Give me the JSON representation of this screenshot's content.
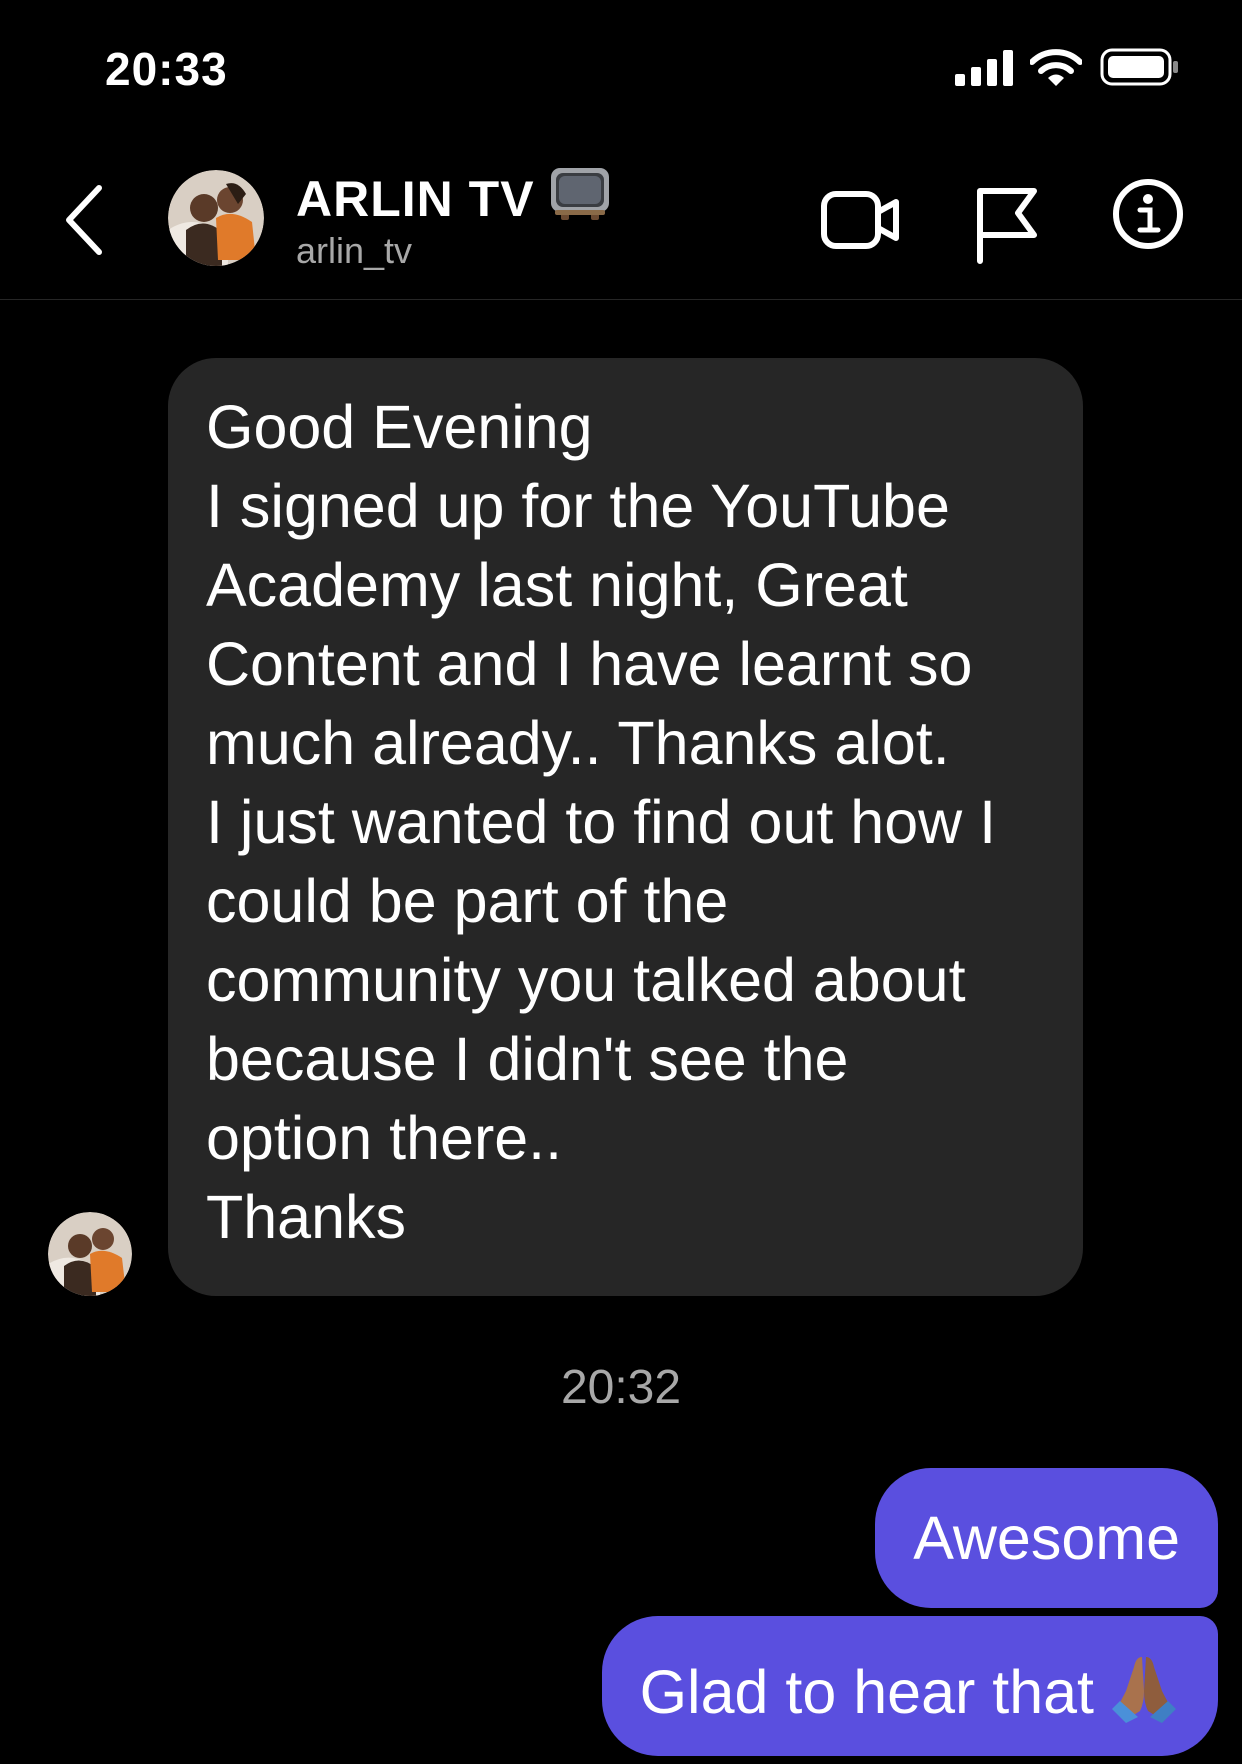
{
  "status_bar": {
    "time": "20:33"
  },
  "header": {
    "name": "ARLIN TV",
    "username": "arlin_tv",
    "icons": [
      "back-icon",
      "tv-icon",
      "video-call-icon",
      "flag-icon",
      "info-icon"
    ]
  },
  "messages": {
    "incoming": {
      "lines": [
        "Good Evening",
        "I signed up for the YouTube",
        "Academy last night, Great",
        "Content and I have learnt so",
        "much already.. Thanks alot.",
        "I just wanted to find out how I",
        "could be part of the",
        "community you talked about",
        "because I didn't see the",
        "option there..",
        "Thanks"
      ]
    },
    "timestamp": "20:32",
    "outgoing": [
      {
        "text": "Awesome"
      },
      {
        "text": "Glad to hear that",
        "emoji_icon": "praying-hands-icon"
      }
    ]
  },
  "colors": {
    "background": "#000000",
    "incoming_bubble": "#262626",
    "outgoing_bubble": "#5a4fdf",
    "secondary_text": "#a8a8a8"
  }
}
